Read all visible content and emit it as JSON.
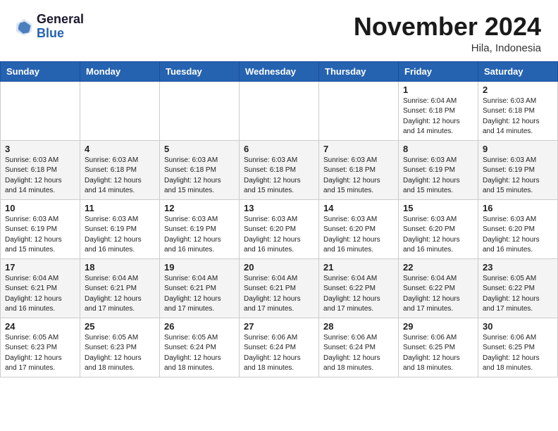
{
  "header": {
    "logo_general": "General",
    "logo_blue": "Blue",
    "month_title": "November 2024",
    "location": "Hila, Indonesia"
  },
  "weekdays": [
    "Sunday",
    "Monday",
    "Tuesday",
    "Wednesday",
    "Thursday",
    "Friday",
    "Saturday"
  ],
  "rows": [
    [
      {
        "day": "",
        "info": ""
      },
      {
        "day": "",
        "info": ""
      },
      {
        "day": "",
        "info": ""
      },
      {
        "day": "",
        "info": ""
      },
      {
        "day": "",
        "info": ""
      },
      {
        "day": "1",
        "info": "Sunrise: 6:04 AM\nSunset: 6:18 PM\nDaylight: 12 hours\nand 14 minutes."
      },
      {
        "day": "2",
        "info": "Sunrise: 6:03 AM\nSunset: 6:18 PM\nDaylight: 12 hours\nand 14 minutes."
      }
    ],
    [
      {
        "day": "3",
        "info": "Sunrise: 6:03 AM\nSunset: 6:18 PM\nDaylight: 12 hours\nand 14 minutes."
      },
      {
        "day": "4",
        "info": "Sunrise: 6:03 AM\nSunset: 6:18 PM\nDaylight: 12 hours\nand 14 minutes."
      },
      {
        "day": "5",
        "info": "Sunrise: 6:03 AM\nSunset: 6:18 PM\nDaylight: 12 hours\nand 15 minutes."
      },
      {
        "day": "6",
        "info": "Sunrise: 6:03 AM\nSunset: 6:18 PM\nDaylight: 12 hours\nand 15 minutes."
      },
      {
        "day": "7",
        "info": "Sunrise: 6:03 AM\nSunset: 6:18 PM\nDaylight: 12 hours\nand 15 minutes."
      },
      {
        "day": "8",
        "info": "Sunrise: 6:03 AM\nSunset: 6:19 PM\nDaylight: 12 hours\nand 15 minutes."
      },
      {
        "day": "9",
        "info": "Sunrise: 6:03 AM\nSunset: 6:19 PM\nDaylight: 12 hours\nand 15 minutes."
      }
    ],
    [
      {
        "day": "10",
        "info": "Sunrise: 6:03 AM\nSunset: 6:19 PM\nDaylight: 12 hours\nand 15 minutes."
      },
      {
        "day": "11",
        "info": "Sunrise: 6:03 AM\nSunset: 6:19 PM\nDaylight: 12 hours\nand 16 minutes."
      },
      {
        "day": "12",
        "info": "Sunrise: 6:03 AM\nSunset: 6:19 PM\nDaylight: 12 hours\nand 16 minutes."
      },
      {
        "day": "13",
        "info": "Sunrise: 6:03 AM\nSunset: 6:20 PM\nDaylight: 12 hours\nand 16 minutes."
      },
      {
        "day": "14",
        "info": "Sunrise: 6:03 AM\nSunset: 6:20 PM\nDaylight: 12 hours\nand 16 minutes."
      },
      {
        "day": "15",
        "info": "Sunrise: 6:03 AM\nSunset: 6:20 PM\nDaylight: 12 hours\nand 16 minutes."
      },
      {
        "day": "16",
        "info": "Sunrise: 6:03 AM\nSunset: 6:20 PM\nDaylight: 12 hours\nand 16 minutes."
      }
    ],
    [
      {
        "day": "17",
        "info": "Sunrise: 6:04 AM\nSunset: 6:21 PM\nDaylight: 12 hours\nand 16 minutes."
      },
      {
        "day": "18",
        "info": "Sunrise: 6:04 AM\nSunset: 6:21 PM\nDaylight: 12 hours\nand 17 minutes."
      },
      {
        "day": "19",
        "info": "Sunrise: 6:04 AM\nSunset: 6:21 PM\nDaylight: 12 hours\nand 17 minutes."
      },
      {
        "day": "20",
        "info": "Sunrise: 6:04 AM\nSunset: 6:21 PM\nDaylight: 12 hours\nand 17 minutes."
      },
      {
        "day": "21",
        "info": "Sunrise: 6:04 AM\nSunset: 6:22 PM\nDaylight: 12 hours\nand 17 minutes."
      },
      {
        "day": "22",
        "info": "Sunrise: 6:04 AM\nSunset: 6:22 PM\nDaylight: 12 hours\nand 17 minutes."
      },
      {
        "day": "23",
        "info": "Sunrise: 6:05 AM\nSunset: 6:22 PM\nDaylight: 12 hours\nand 17 minutes."
      }
    ],
    [
      {
        "day": "24",
        "info": "Sunrise: 6:05 AM\nSunset: 6:23 PM\nDaylight: 12 hours\nand 17 minutes."
      },
      {
        "day": "25",
        "info": "Sunrise: 6:05 AM\nSunset: 6:23 PM\nDaylight: 12 hours\nand 18 minutes."
      },
      {
        "day": "26",
        "info": "Sunrise: 6:05 AM\nSunset: 6:24 PM\nDaylight: 12 hours\nand 18 minutes."
      },
      {
        "day": "27",
        "info": "Sunrise: 6:06 AM\nSunset: 6:24 PM\nDaylight: 12 hours\nand 18 minutes."
      },
      {
        "day": "28",
        "info": "Sunrise: 6:06 AM\nSunset: 6:24 PM\nDaylight: 12 hours\nand 18 minutes."
      },
      {
        "day": "29",
        "info": "Sunrise: 6:06 AM\nSunset: 6:25 PM\nDaylight: 12 hours\nand 18 minutes."
      },
      {
        "day": "30",
        "info": "Sunrise: 6:06 AM\nSunset: 6:25 PM\nDaylight: 12 hours\nand 18 minutes."
      }
    ]
  ]
}
